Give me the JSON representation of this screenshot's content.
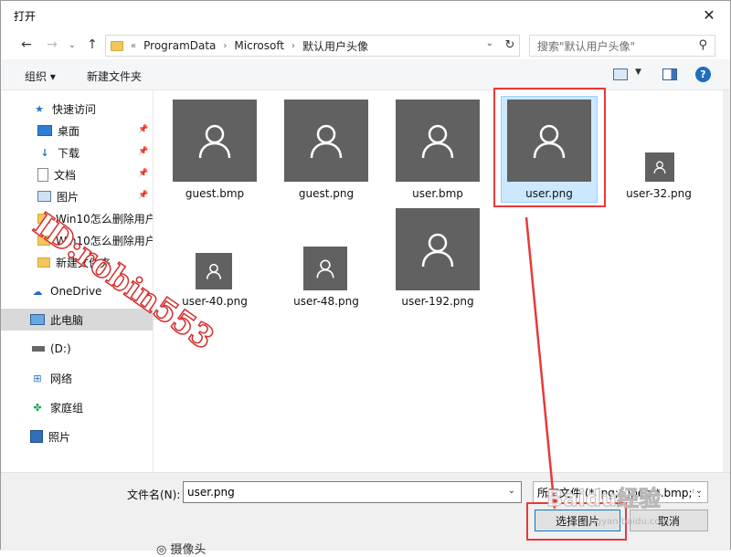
{
  "window": {
    "title": "打开",
    "close_glyph": "✕"
  },
  "nav": {
    "back": "←",
    "forward": "→",
    "recent": "⌄",
    "up": "↑",
    "crumb_prefix": "«",
    "breadcrumbs": [
      "ProgramData",
      "Microsoft",
      "默认用户头像"
    ],
    "chevron": "›",
    "dropdown": "⌄",
    "refresh": "↻",
    "search_placeholder": "搜索\"默认用户头像\"",
    "search_glyph": "⚲"
  },
  "toolbar": {
    "organize": "组织 ▾",
    "new_folder": "新建文件夹",
    "view_drop": "▼",
    "help": "?"
  },
  "sidebar": {
    "items": [
      {
        "label": "快速访问",
        "icon": "star-icon",
        "glyph": "★"
      },
      {
        "label": "桌面",
        "icon": "desktop-icon",
        "pin": "📌"
      },
      {
        "label": "下载",
        "icon": "download-icon",
        "glyph": "↓",
        "pin": "📌"
      },
      {
        "label": "文档",
        "icon": "document-icon",
        "pin": "📌"
      },
      {
        "label": "图片",
        "icon": "pictures-icon",
        "pin": "📌"
      },
      {
        "label": "Win10怎么删除用户",
        "icon": "folder-icon"
      },
      {
        "label": "Win10怎么删除用户",
        "icon": "folder-icon"
      },
      {
        "label": "新建文件夹",
        "icon": "folder-icon"
      },
      {
        "label": "OneDrive",
        "icon": "cloud-icon",
        "glyph": "☁"
      },
      {
        "label": "此电脑",
        "icon": "computer-icon"
      },
      {
        "label": " (D:)",
        "icon": "drive-icon"
      },
      {
        "label": "网络",
        "icon": "network-icon",
        "glyph": "⊞"
      },
      {
        "label": "家庭组",
        "icon": "homegroup-icon",
        "glyph": "✤"
      },
      {
        "label": "照片",
        "icon": "photos-icon"
      }
    ]
  },
  "files": [
    {
      "name": "guest.bmp",
      "size": "large"
    },
    {
      "name": "guest.png",
      "size": "large"
    },
    {
      "name": "user.bmp",
      "size": "large"
    },
    {
      "name": "user.png",
      "size": "large",
      "selected": true
    },
    {
      "name": "user-32.png",
      "size": "small"
    },
    {
      "name": "user-40.png",
      "size": "small"
    },
    {
      "name": "user-48.png",
      "size": "medium"
    },
    {
      "name": "user-192.png",
      "size": "large"
    }
  ],
  "bottom": {
    "filename_label": "文件名(N):",
    "filename_value": "user.png",
    "filter_value": "所有文件 (*.jpg;*.jpeg;*.bmp;*.",
    "open_button": "选择图片",
    "cancel_button": "取消",
    "dropdown": "⌄"
  },
  "overlay": {
    "watermark": "ID:robin553",
    "baidu_logo": "Baidu经验",
    "baidu_url": "jingyan.baidu.com",
    "cutoff_text": "◎ 摄像头"
  },
  "colors": {
    "accent": "#0078d7",
    "thumb": "#616161",
    "selection": "#cce8ff",
    "annotation": "#e8393a"
  }
}
